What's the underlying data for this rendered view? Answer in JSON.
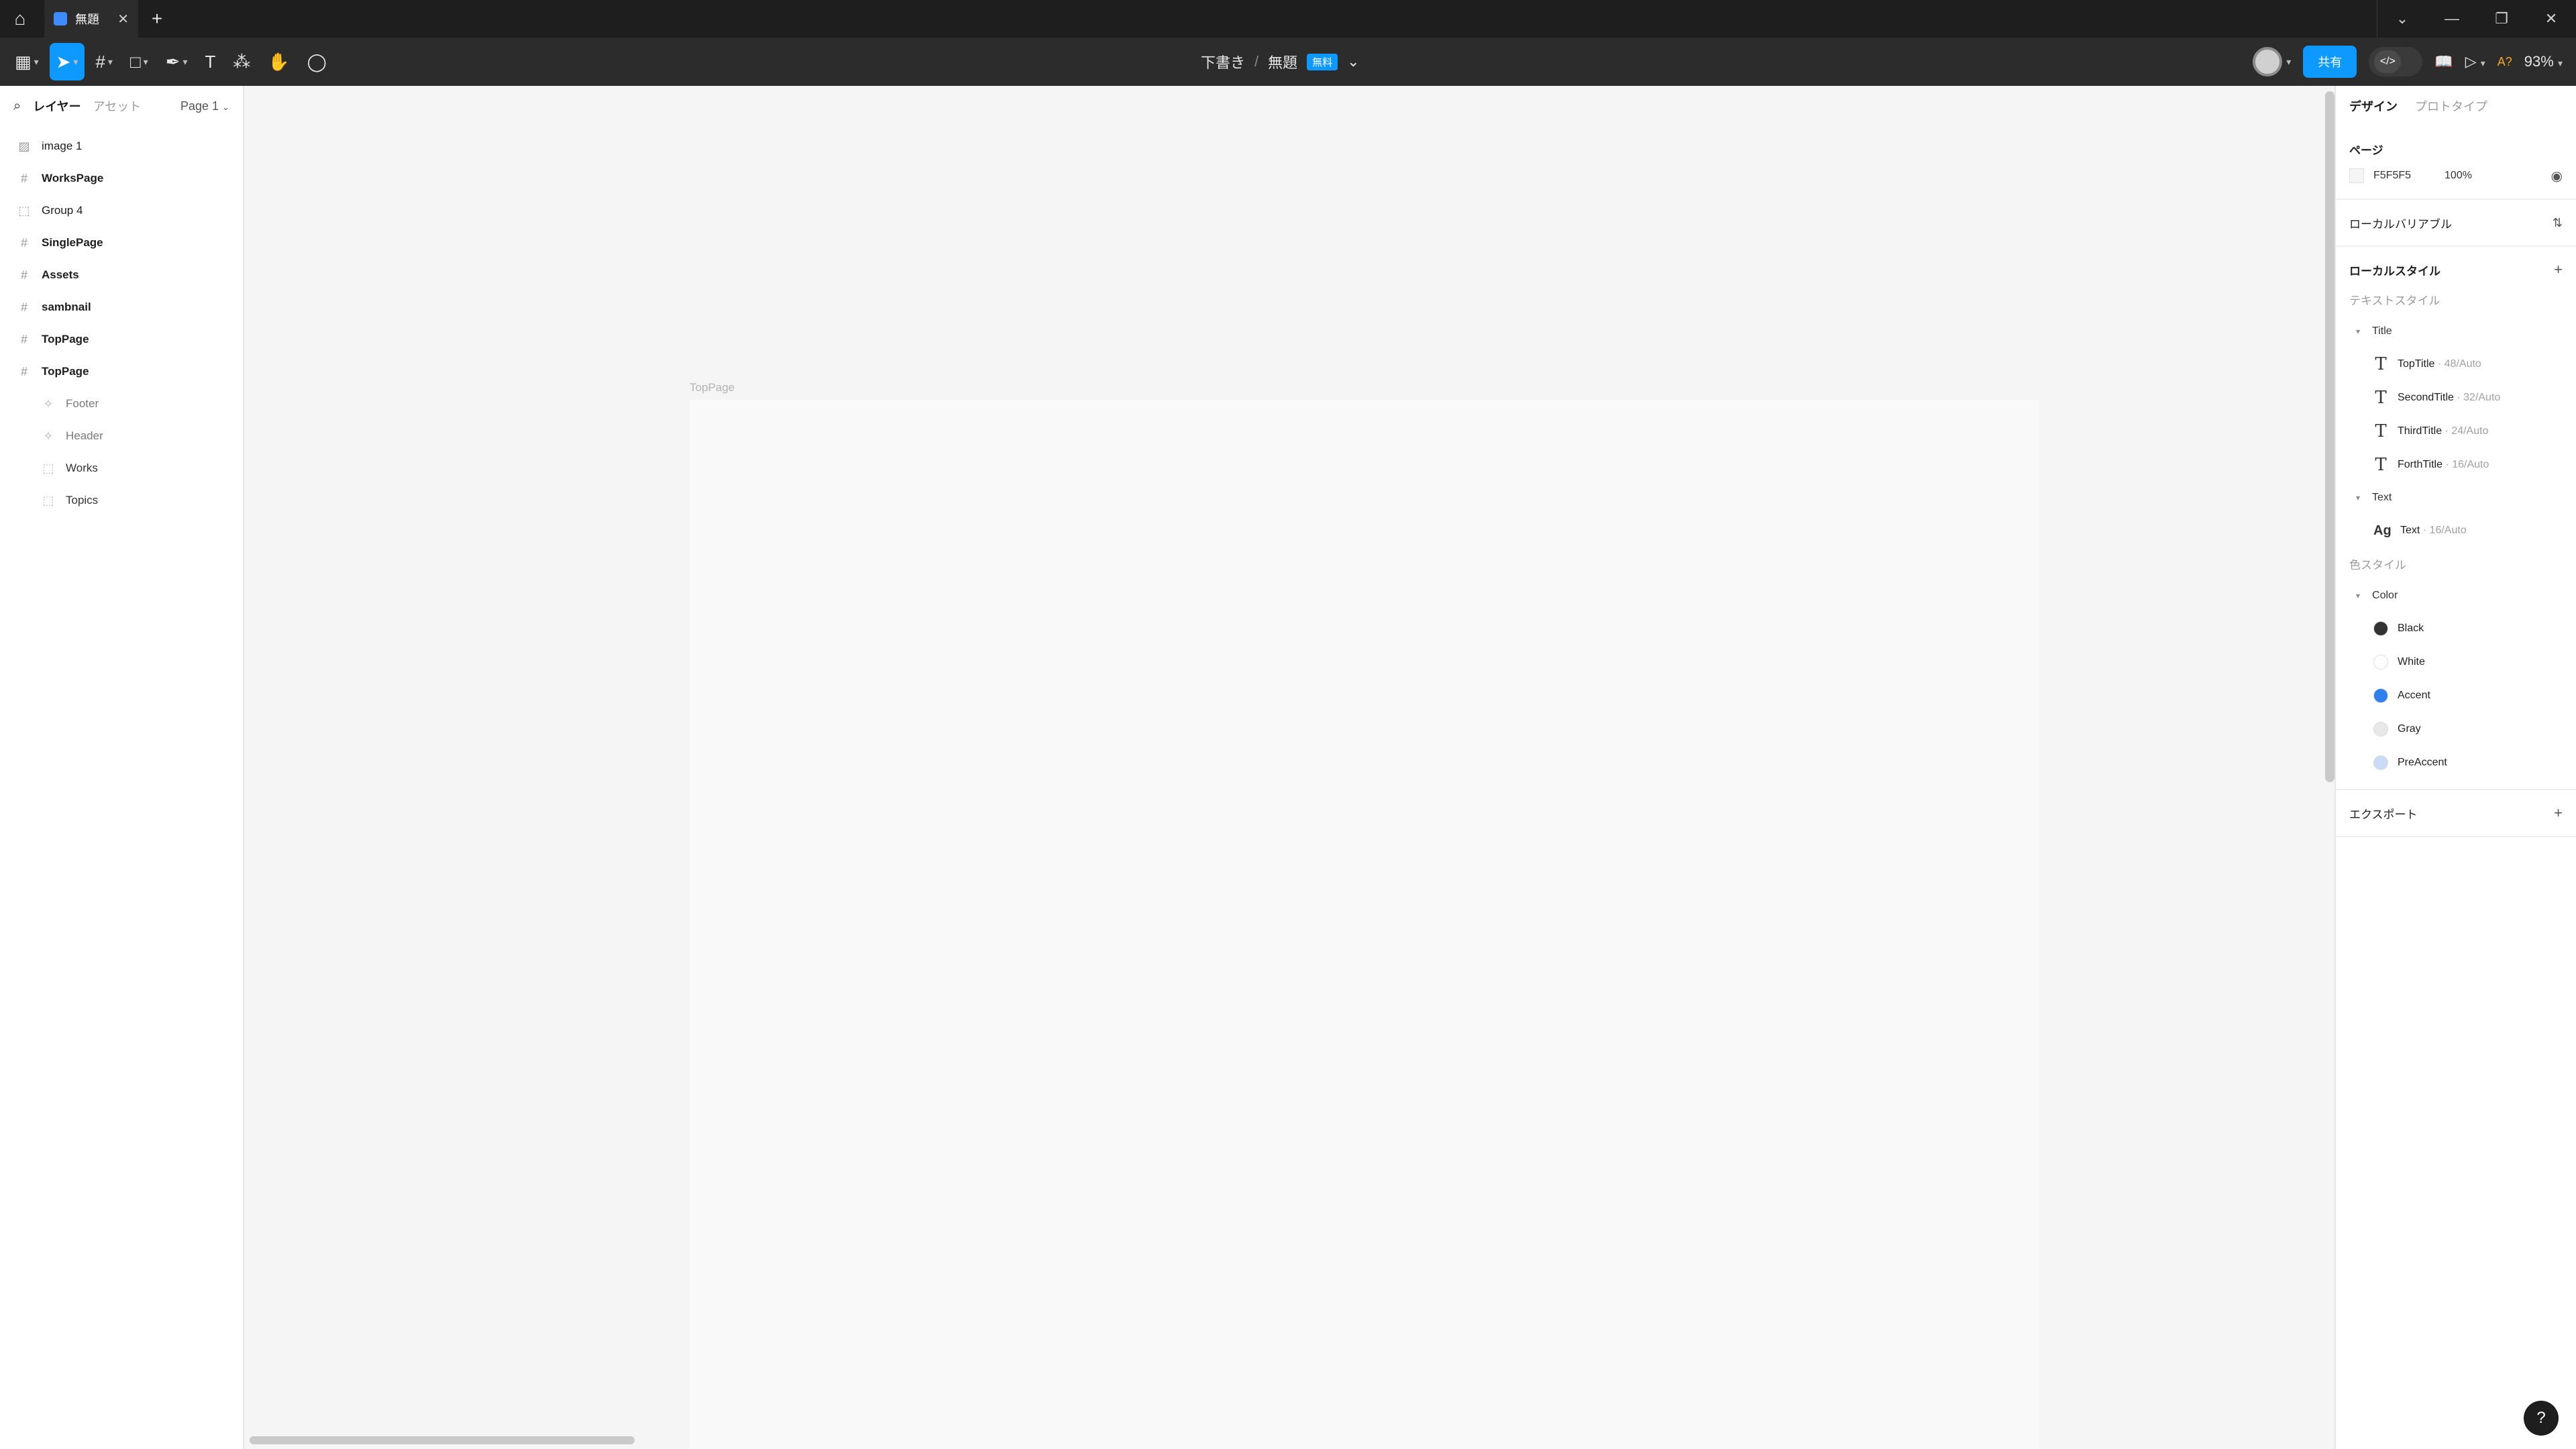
{
  "tabbar": {
    "tab_title": "無題"
  },
  "toolbar": {
    "breadcrumb_folder": "下書き",
    "separator": "/",
    "file_name": "無題",
    "plan_badge": "無料",
    "share_label": "共有",
    "ai_label": "A?",
    "zoom": "93%"
  },
  "left_panel": {
    "tab_layers": "レイヤー",
    "tab_assets": "アセット",
    "page_selector": "Page 1",
    "layers": [
      {
        "label": "image 1",
        "icon": "image-icon"
      },
      {
        "label": "WorksPage",
        "icon": "frame-icon"
      },
      {
        "label": "Group 4",
        "icon": "group-icon"
      },
      {
        "label": "SinglePage",
        "icon": "frame-icon"
      },
      {
        "label": "Assets",
        "icon": "frame-icon"
      },
      {
        "label": "sambnail",
        "icon": "frame-icon"
      },
      {
        "label": "TopPage",
        "icon": "frame-icon"
      },
      {
        "label": "TopPage",
        "icon": "frame-icon"
      },
      {
        "label": "Footer",
        "icon": "component-instance-icon"
      },
      {
        "label": "Header",
        "icon": "component-instance-icon"
      },
      {
        "label": "Works",
        "icon": "group-icon"
      },
      {
        "label": "Topics",
        "icon": "group-icon"
      }
    ]
  },
  "canvas": {
    "frame_label": "TopPage"
  },
  "right_panel": {
    "tab_design": "デザイン",
    "tab_prototype": "プロトタイプ",
    "page_section": "ページ",
    "page_color_hex": "F5F5F5",
    "page_opacity": "100%",
    "local_variables": "ローカルバリアブル",
    "local_styles": "ローカルスタイル",
    "text_styles_label": "テキストスタイル",
    "text_groups": [
      {
        "name": "Title",
        "styles": [
          {
            "name": "TopTitle",
            "meta": " · 48/Auto"
          },
          {
            "name": "SecondTitle",
            "meta": " · 32/Auto"
          },
          {
            "name": "ThirdTitle",
            "meta": " · 24/Auto"
          },
          {
            "name": "ForthTitle",
            "meta": " · 16/Auto"
          }
        ]
      },
      {
        "name": "Text",
        "styles": [
          {
            "name": "Text",
            "meta": " · 16/Auto"
          }
        ]
      }
    ],
    "color_styles_label": "色スタイル",
    "color_group": "Color",
    "colors": [
      {
        "name": "Black",
        "hex": "#333333"
      },
      {
        "name": "White",
        "hex": "#ffffff"
      },
      {
        "name": "Accent",
        "hex": "#2f80ed"
      },
      {
        "name": "Gray",
        "hex": "#e8e8e8"
      },
      {
        "name": "PreAccent",
        "hex": "#c8dcf5"
      }
    ],
    "export_label": "エクスポート"
  },
  "help_label": "?"
}
